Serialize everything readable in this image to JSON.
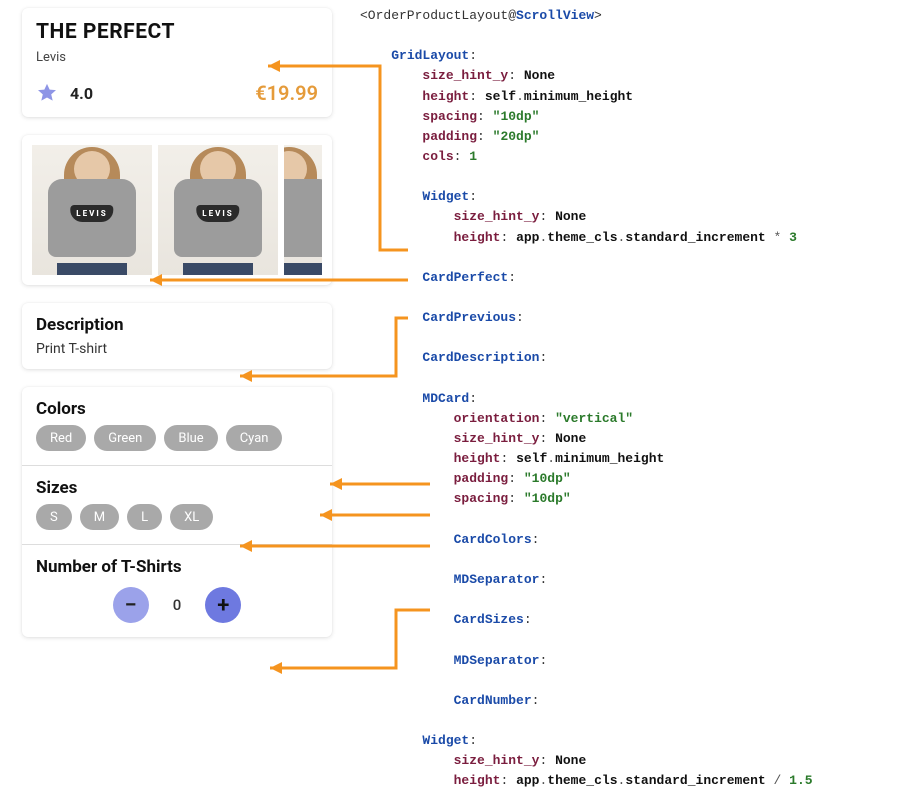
{
  "perfect": {
    "title": "THE PERFECT",
    "brand": "Levis",
    "rating": "4.0",
    "price": "€19.99"
  },
  "preview": {
    "logo": "LEVIS"
  },
  "description": {
    "heading": "Description",
    "text": "Print T-shirt"
  },
  "colors": {
    "heading": "Colors",
    "items": [
      "Red",
      "Green",
      "Blue",
      "Cyan"
    ]
  },
  "sizes": {
    "heading": "Sizes",
    "items": [
      "S",
      "M",
      "L",
      "XL"
    ]
  },
  "number": {
    "heading": "Number of T-Shirts",
    "value": "0",
    "minus": "−",
    "plus": "+"
  },
  "code": {
    "l0_a": "<OrderProductLayout@",
    "l0_b": "ScrollView",
    "l0_c": ">",
    "gridlayout": "GridLayout",
    "size_hint_y": "size_hint_y",
    "none": "None",
    "height": "height",
    "self_min": "self",
    "dot": ".",
    "min_h": "minimum_height",
    "spacing": "spacing",
    "v10": "\"10dp\"",
    "padding": "padding",
    "v20": "\"20dp\"",
    "cols": "cols",
    "one": "1",
    "widget": "Widget",
    "app": "app",
    "theme": "theme_cls",
    "std": "standard_increment",
    "times": " * ",
    "three": "3",
    "cardperfect": "CardPerfect",
    "cardprevious": "CardPrevious",
    "carddesc": "CardDescription",
    "mdcard": "MDCard",
    "orientation": "orientation",
    "vertical": "\"vertical\"",
    "cardcolors": "CardColors",
    "mdsep": "MDSeparator",
    "cardsizes": "CardSizes",
    "cardnumber": "CardNumber",
    "div": " / ",
    "onepointfive": "1.5",
    "colon": ":"
  }
}
